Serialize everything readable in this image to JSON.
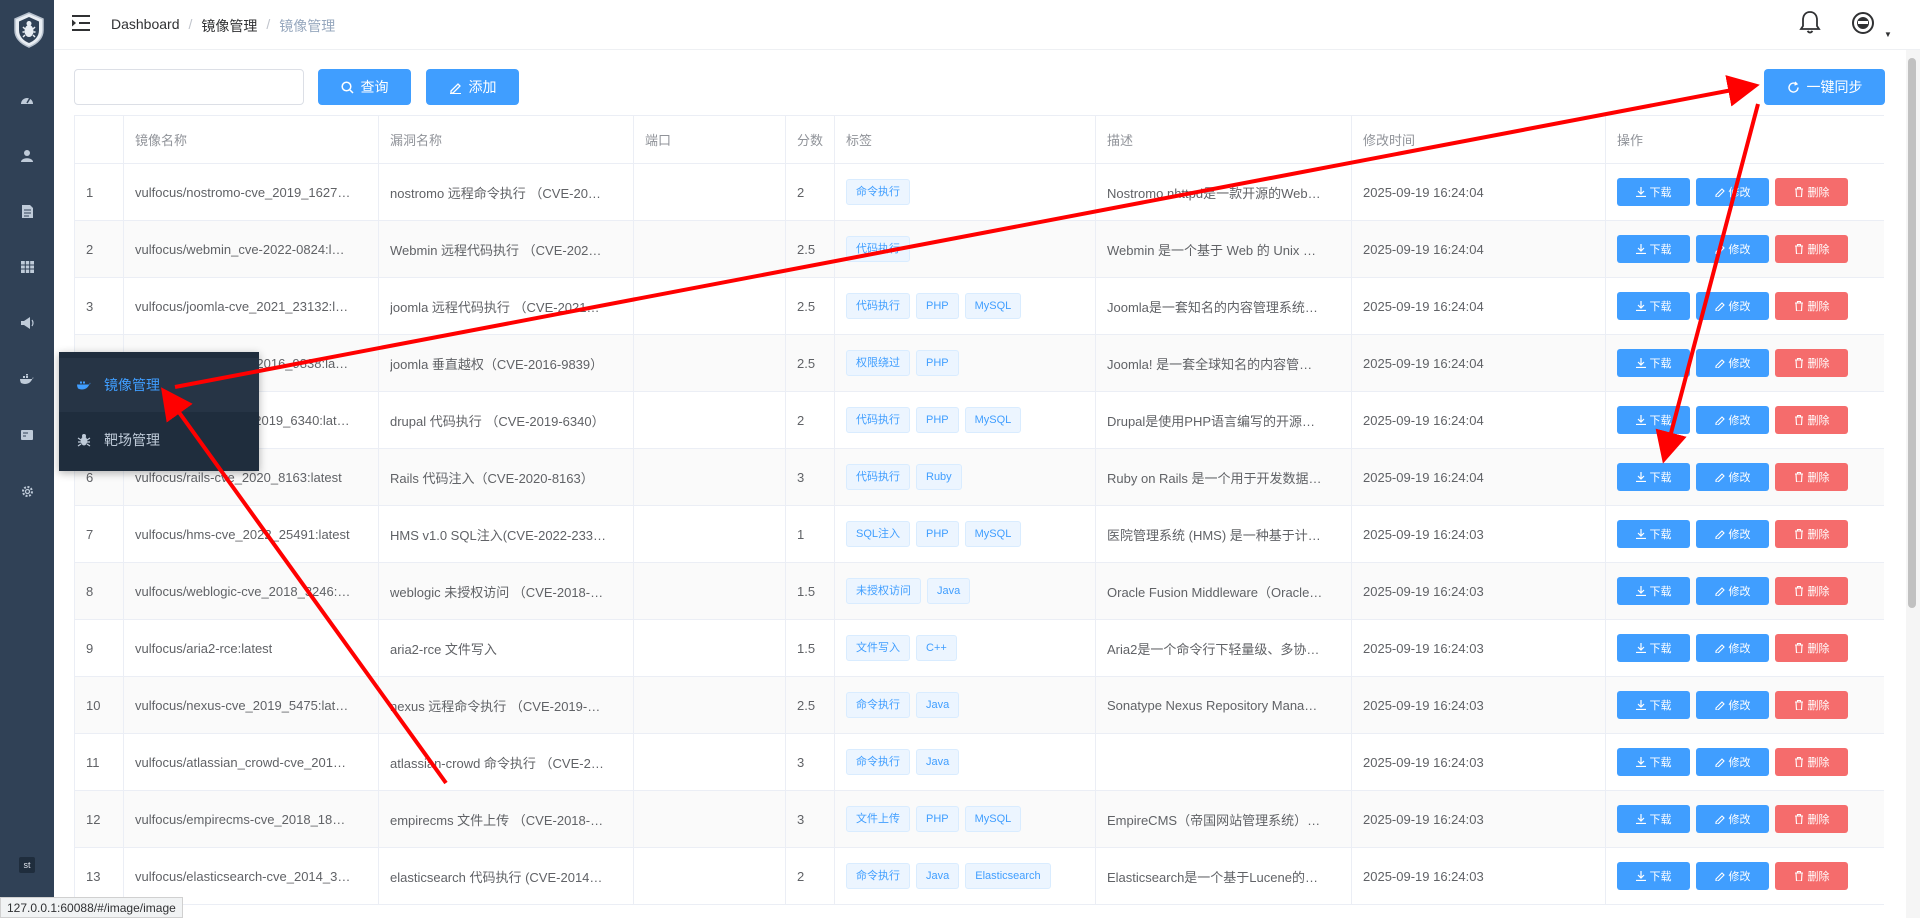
{
  "breadcrumb": [
    "Dashboard",
    "镜像管理",
    "镜像管理"
  ],
  "toolbar": {
    "search_value": "",
    "query_label": "查询",
    "add_label": "添加",
    "sync_label": "一键同步"
  },
  "sidebar": {
    "icons": [
      "dashboard-icon",
      "user-icon",
      "document-icon",
      "table-icon",
      "megaphone-icon",
      "docker-icon",
      "card-icon",
      "gear-icon"
    ],
    "bottom_badge": "st",
    "submenu": [
      {
        "label": "镜像管理",
        "active": true
      },
      {
        "label": "靶场管理",
        "active": false
      }
    ]
  },
  "table": {
    "headers": [
      "",
      "镜像名称",
      "漏洞名称",
      "端口",
      "分数",
      "标签",
      "描述",
      "修改时间",
      "操作"
    ],
    "actions": {
      "download": "下载",
      "edit": "修改",
      "delete": "删除"
    },
    "rows": [
      {
        "id": "1",
        "image": "vulfocus/nostromo-cve_2019_1627…",
        "vuln": "nostromo 远程命令执行 （CVE-20…",
        "port": "",
        "score": "2",
        "tags": [
          "命令执行"
        ],
        "desc": "Nostromo nhttpd是一款开源的Web…",
        "time": "2025-09-19 16:24:04"
      },
      {
        "id": "2",
        "image": "vulfocus/webmin_cve-2022-0824:l…",
        "vuln": "Webmin 远程代码执行 （CVE-202…",
        "port": "",
        "score": "2.5",
        "tags": [
          "代码执行"
        ],
        "desc": "Webmin 是一个基于 Web 的 Unix …",
        "time": "2025-09-19 16:24:04"
      },
      {
        "id": "3",
        "image": "vulfocus/joomla-cve_2021_23132:l…",
        "vuln": "joomla 远程代码执行 （CVE-2021…",
        "port": "",
        "score": "2.5",
        "tags": [
          "代码执行",
          "PHP",
          "MySQL"
        ],
        "desc": "Joomla是一套知名的内容管理系统…",
        "time": "2025-09-19 16:24:04"
      },
      {
        "id": "4",
        "image": "vulfocus/joomla-cve_2016_9838:la…",
        "vuln": "joomla 垂直越权（CVE-2016-9839）",
        "port": "",
        "score": "2.5",
        "tags": [
          "权限绕过",
          "PHP"
        ],
        "desc": "Joomla! 是一套全球知名的内容管…",
        "time": "2025-09-19 16:24:04"
      },
      {
        "id": "5",
        "image": "vulfocus/drupal-cve_2019_6340:lat…",
        "vuln": "drupal 代码执行 （CVE-2019-6340）",
        "port": "",
        "score": "2",
        "tags": [
          "代码执行",
          "PHP",
          "MySQL"
        ],
        "desc": "Drupal是使用PHP语言编写的开源…",
        "time": "2025-09-19 16:24:04"
      },
      {
        "id": "6",
        "image": "vulfocus/rails-cve_2020_8163:latest",
        "vuln": "Rails 代码注入（CVE-2020-8163）",
        "port": "",
        "score": "3",
        "tags": [
          "代码执行",
          "Ruby"
        ],
        "desc": "Ruby on Rails 是一个用于开发数据…",
        "time": "2025-09-19 16:24:04"
      },
      {
        "id": "7",
        "image": "vulfocus/hms-cve_2022_25491:latest",
        "vuln": "HMS v1.0 SQL注入(CVE-2022-233…",
        "port": "",
        "score": "1",
        "tags": [
          "SQL注入",
          "PHP",
          "MySQL"
        ],
        "desc": "医院管理系统 (HMS) 是一种基于计…",
        "time": "2025-09-19 16:24:03"
      },
      {
        "id": "8",
        "image": "vulfocus/weblogic-cve_2018_3246:…",
        "vuln": "weblogic 未授权访问 （CVE-2018-…",
        "port": "",
        "score": "1.5",
        "tags": [
          "未授权访问",
          "Java"
        ],
        "desc": "Oracle Fusion Middleware（Oracle…",
        "time": "2025-09-19 16:24:03"
      },
      {
        "id": "9",
        "image": "vulfocus/aria2-rce:latest",
        "vuln": "aria2-rce 文件写入",
        "port": "",
        "score": "1.5",
        "tags": [
          "文件写入",
          "C++"
        ],
        "desc": "Aria2是一个命令行下轻量级、多协…",
        "time": "2025-09-19 16:24:03"
      },
      {
        "id": "10",
        "image": "vulfocus/nexus-cve_2019_5475:lat…",
        "vuln": "nexus 远程命令执行 （CVE-2019-…",
        "port": "",
        "score": "2.5",
        "tags": [
          "命令执行",
          "Java"
        ],
        "desc": "Sonatype Nexus Repository Mana…",
        "time": "2025-09-19 16:24:03"
      },
      {
        "id": "11",
        "image": "vulfocus/atlassian_crowd-cve_201…",
        "vuln": "atlassian-crowd 命令执行 （CVE-2…",
        "port": "",
        "score": "3",
        "tags": [
          "命令执行",
          "Java"
        ],
        "desc": "",
        "time": "2025-09-19 16:24:03"
      },
      {
        "id": "12",
        "image": "vulfocus/empirecms-cve_2018_18…",
        "vuln": "empirecms 文件上传 （CVE-2018-…",
        "port": "",
        "score": "3",
        "tags": [
          "文件上传",
          "PHP",
          "MySQL"
        ],
        "desc": "EmpireCMS（帝国网站管理系统）…",
        "time": "2025-09-19 16:24:03"
      },
      {
        "id": "13",
        "image": "vulfocus/elasticsearch-cve_2014_3…",
        "vuln": "elasticsearch 代码执行 (CVE-2014…",
        "port": "",
        "score": "2",
        "tags": [
          "命令执行",
          "Java",
          "Elasticsearch"
        ],
        "desc": "Elasticsearch是一个基于Lucene的…",
        "time": "2025-09-19 16:24:03"
      }
    ]
  },
  "status_url": "127.0.0.1:60088/#/image/image",
  "colors": {
    "primary": "#409eff",
    "danger": "#f56c6c",
    "sidebar": "#304156",
    "annotation": "#ff0000"
  }
}
